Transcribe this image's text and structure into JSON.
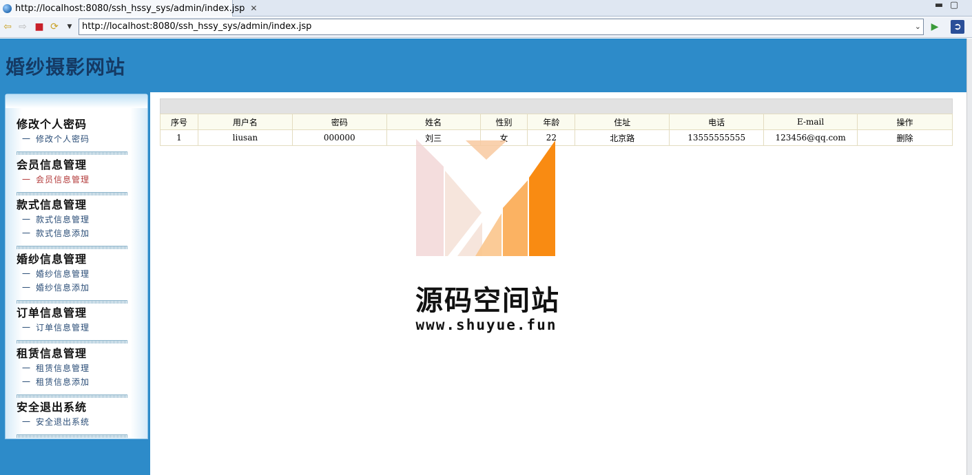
{
  "browser": {
    "tab_title": "http://localhost:8080/ssh_hssy_sys/admin/index.jsp",
    "address": "http://localhost:8080/ssh_hssy_sys/admin/index.jsp"
  },
  "site": {
    "title": "婚纱摄影网站"
  },
  "menu": {
    "groups": [
      {
        "heading": "修改个人密码",
        "links": [
          "修改个人密码"
        ]
      },
      {
        "heading": "会员信息管理",
        "links": [
          "会员信息管理"
        ]
      },
      {
        "heading": "款式信息管理",
        "links": [
          "款式信息管理",
          "款式信息添加"
        ]
      },
      {
        "heading": "婚纱信息管理",
        "links": [
          "婚纱信息管理",
          "婚纱信息添加"
        ]
      },
      {
        "heading": "订单信息管理",
        "links": [
          "订单信息管理"
        ]
      },
      {
        "heading": "租赁信息管理",
        "links": [
          "租赁信息管理",
          "租赁信息添加"
        ]
      },
      {
        "heading": "安全退出系统",
        "links": [
          "安全退出系统"
        ]
      }
    ],
    "link_dash": "一"
  },
  "table": {
    "columns": [
      "序号",
      "用户名",
      "密码",
      "姓名",
      "性别",
      "年龄",
      "住址",
      "电话",
      "E-mail",
      "操作"
    ],
    "rows": [
      [
        "1",
        "liusan",
        "000000",
        "刘三",
        "女",
        "22",
        "北京路",
        "13555555555",
        "123456@qq.com",
        "删除"
      ]
    ]
  },
  "watermark": {
    "name": "源码空间站",
    "url": "www.shuyue.fun"
  },
  "colors": {
    "header_bg": "#2d8bc9",
    "title_color": "#153a64",
    "active_link": "#b33b3b"
  }
}
